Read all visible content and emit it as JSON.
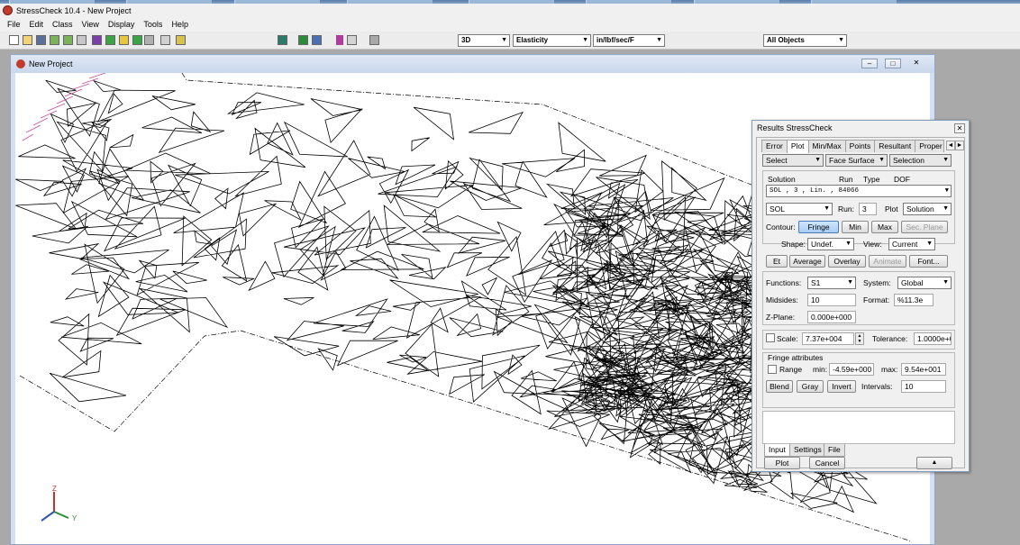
{
  "app": {
    "title": "StressCheck 10.4 - New Project"
  },
  "menu": [
    "File",
    "Edit",
    "Class",
    "View",
    "Display",
    "Tools",
    "Help"
  ],
  "toolbar": {
    "view_mode": "3D",
    "material": "Elasticity",
    "units": "in/lbf/sec/F",
    "object_filter": "All Objects"
  },
  "project_window": {
    "title": "New Project"
  },
  "triad": {
    "z": "Z",
    "y": "Y"
  },
  "dialog": {
    "title": "Results StressCheck",
    "tabs": [
      "Error",
      "Plot",
      "Min/Max",
      "Points",
      "Resultant",
      "Proper"
    ],
    "active_tab": "Plot",
    "select_row": {
      "select": "Select",
      "entity": "Face Surface",
      "selection": "Selection"
    },
    "solution_header": {
      "solution": "Solution",
      "run": "Run",
      "type": "Type",
      "dof": "DOF"
    },
    "solution_value": "SOL                , 3  , Lin.     , 84066",
    "sol_combo": "SOL",
    "run_label": "Run:",
    "run_value": "3",
    "plot_label": "Plot",
    "plot_value": "Solution",
    "contour_label": "Contour:",
    "contour_buttons": {
      "fringe": "Fringe",
      "min": "Min",
      "max": "Max",
      "sec_plane": "Sec. Plane"
    },
    "shape_label": "Shape:",
    "shape_value": "Undef.",
    "view_label": "View:",
    "view_value": "Current",
    "action_buttons": {
      "et": "Et",
      "average": "Average",
      "overlay": "Overlay",
      "animate": "Animate",
      "font": "Font..."
    },
    "functions_label": "Functions:",
    "functions_value": "S1",
    "system_label": "System:",
    "system_value": "Global",
    "midsides_label": "Midsides:",
    "midsides_value": "10",
    "format_label": "Format:",
    "format_value": "%11.3e",
    "zplane_label": "Z-Plane:",
    "zplane_value": "0.000e+000",
    "scale_label": "Scale:",
    "scale_value": "7.37e+004",
    "tolerance_label": "Tolerance:",
    "tolerance_value": "1.0000e+0",
    "fringe_attr_label": "Fringe attributes",
    "range_label": "Range",
    "min_label": "min:",
    "min_value": "-4.59e+000",
    "max_label": "max:",
    "max_value": "9.54e+001",
    "fringe_buttons": {
      "blend": "Blend",
      "gray": "Gray",
      "invert": "Invert"
    },
    "intervals_label": "Intervals:",
    "intervals_value": "10",
    "bottom_tabs": [
      "Input",
      "Settings",
      "File"
    ],
    "footer_buttons": {
      "plot": "Plot",
      "cancel": "Cancel",
      "up": "▲"
    }
  }
}
